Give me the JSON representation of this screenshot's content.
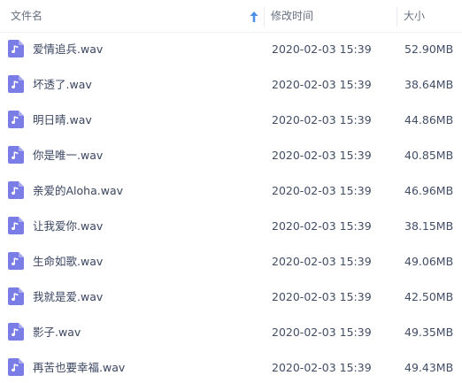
{
  "header": {
    "name_label": "文件名",
    "time_label": "修改时间",
    "size_label": "大小",
    "sort_direction": "ascending"
  },
  "colors": {
    "icon_bg": "#7b7de6",
    "sort_arrow": "#4a8fe8"
  },
  "files": [
    {
      "name": "爱情追兵.wav",
      "time": "2020-02-03 15:39",
      "size": "52.90MB",
      "icon": "audio-file-icon"
    },
    {
      "name": "坏透了.wav",
      "time": "2020-02-03 15:39",
      "size": "38.64MB",
      "icon": "audio-file-icon"
    },
    {
      "name": "明日晴.wav",
      "time": "2020-02-03 15:39",
      "size": "44.86MB",
      "icon": "audio-file-icon"
    },
    {
      "name": "你是唯一.wav",
      "time": "2020-02-03 15:39",
      "size": "40.85MB",
      "icon": "audio-file-icon"
    },
    {
      "name": "亲爱的Aloha.wav",
      "time": "2020-02-03 15:39",
      "size": "46.96MB",
      "icon": "audio-file-icon"
    },
    {
      "name": "让我爱你.wav",
      "time": "2020-02-03 15:39",
      "size": "38.15MB",
      "icon": "audio-file-icon"
    },
    {
      "name": "生命如歌.wav",
      "time": "2020-02-03 15:39",
      "size": "49.06MB",
      "icon": "audio-file-icon"
    },
    {
      "name": "我就是爱.wav",
      "time": "2020-02-03 15:39",
      "size": "42.50MB",
      "icon": "audio-file-icon"
    },
    {
      "name": "影子.wav",
      "time": "2020-02-03 15:39",
      "size": "49.35MB",
      "icon": "audio-file-icon"
    },
    {
      "name": "再苦也要幸福.wav",
      "time": "2020-02-03 15:39",
      "size": "49.43MB",
      "icon": "audio-file-icon"
    }
  ]
}
